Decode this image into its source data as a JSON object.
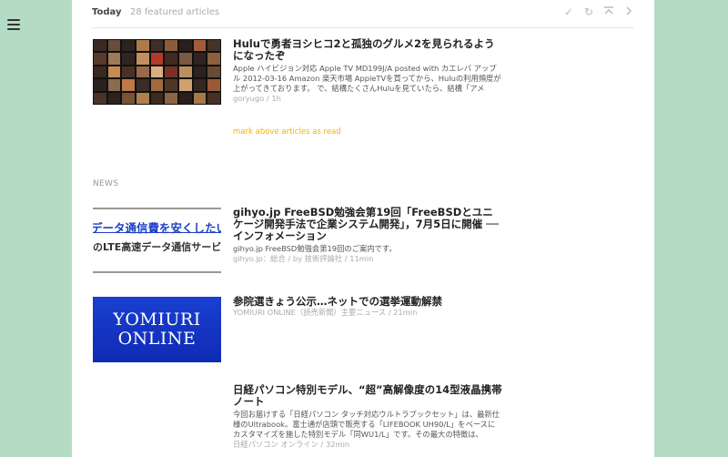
{
  "header": {
    "title": "Today",
    "subtitle": "28 featured articles",
    "icons": [
      "check-icon",
      "refresh-icon",
      "collapse-up-icon",
      "chevron-right-icon"
    ]
  },
  "sidebar": {
    "menu_icon": "hamburger-menu-icon"
  },
  "featured": [
    {
      "title": "Huluで勇者ヨシヒコ2と孤独のグルメ2を見られるようになったぞ",
      "snippet": "Apple ハイビジョン対応 Apple TV MD199J/A posted with カエレバ アップル 2012-03-16 Amazon 楽天市場 AppleTVを買ってから、Huluの利用頻度が上がってきております。 で、結構たくさんHuluを見ていたら、結構「アメ",
      "meta": "goryugo / 1h"
    }
  ],
  "mark_link": "mark above articles as read",
  "section": {
    "label": "NEWS",
    "articles": [
      {
        "title": "gihyo.jp FreeBSD勉強会第19回「FreeBSDとユニケージ開発手法で企業システム開発」，7月5日に開催 ── インフォメーション",
        "snippet": "gihyo.jp FreeBSD勉強会第19回のご案内です。",
        "meta": "gihyo.jp：総合 / by 技術評論社 / 11min",
        "thumb_text_1": "データ通信費を安くしたい",
        "thumb_text_2": "のLTE高速データ通信サービ"
      },
      {
        "title": "参院選きょう公示…ネットでの選挙運動解禁",
        "snippet": "",
        "meta": "YOMIURI ONLINE（読売新聞）主要ニュース / 21min",
        "thumb_text_1": "YOMIURI",
        "thumb_text_2": "ONLINE"
      },
      {
        "title": "日経パソコン特別モデル、“超”高解像度の14型液晶携帯ノート",
        "snippet": "今回お届けする「日経パソコン タッチ対応ウルトラブックセット」は、最新仕様のUltrabook。富士通が店頭で販売する「LIFEBOOK UH90/L」をベースにカスタマイズを施した特別モデル「同WU1/L」です。その最大の特徴は、",
        "meta": "日経パソコン オンライン / 32min"
      }
    ]
  }
}
